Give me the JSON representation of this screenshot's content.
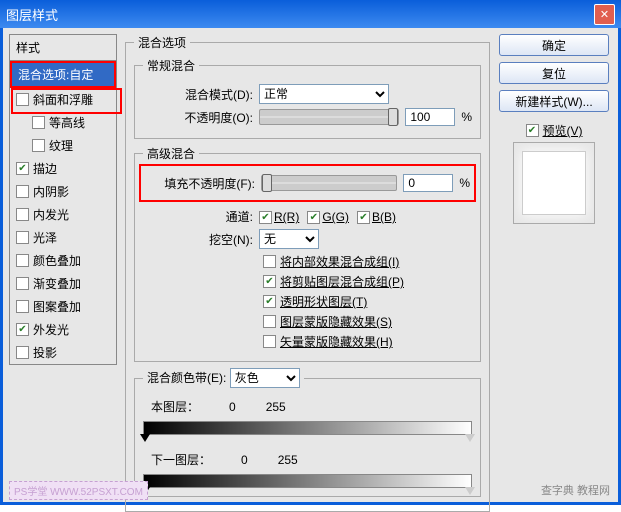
{
  "title": "图层样式",
  "leftcol": {
    "header": "样式",
    "selected": "混合选项:自定",
    "items": [
      {
        "label": "斜面和浮雕",
        "checked": false,
        "indent": false
      },
      {
        "label": "等高线",
        "checked": false,
        "indent": true
      },
      {
        "label": "纹理",
        "checked": false,
        "indent": true
      },
      {
        "label": "描边",
        "checked": true,
        "indent": false
      },
      {
        "label": "内阴影",
        "checked": false,
        "indent": false
      },
      {
        "label": "内发光",
        "checked": false,
        "indent": false
      },
      {
        "label": "光泽",
        "checked": false,
        "indent": false
      },
      {
        "label": "颜色叠加",
        "checked": false,
        "indent": false
      },
      {
        "label": "渐变叠加",
        "checked": false,
        "indent": false
      },
      {
        "label": "图案叠加",
        "checked": false,
        "indent": false
      },
      {
        "label": "外发光",
        "checked": true,
        "indent": false
      },
      {
        "label": "投影",
        "checked": false,
        "indent": false
      }
    ]
  },
  "blend": {
    "groupTitle": "混合选项",
    "normal": {
      "legend": "常规混合",
      "modeLabel": "混合模式(D):",
      "modeValue": "正常",
      "opacityLabel": "不透明度(O):",
      "opacityValue": "100",
      "percent": "%"
    },
    "advanced": {
      "legend": "高级混合",
      "fillLabel": "填充不透明度(F):",
      "fillValue": "0",
      "percent": "%",
      "channelsLabel": "通道:",
      "channels": [
        {
          "label": "R(R)",
          "checked": true
        },
        {
          "label": "G(G)",
          "checked": true
        },
        {
          "label": "B(B)",
          "checked": true
        }
      ],
      "knockoutLabel": "挖空(N):",
      "knockoutValue": "无",
      "options": [
        {
          "label": "将内部效果混合成组(I)",
          "checked": false
        },
        {
          "label": "将剪贴图层混合成组(P)",
          "checked": true
        },
        {
          "label": "透明形状图层(T)",
          "checked": true
        },
        {
          "label": "图层蒙版隐藏效果(S)",
          "checked": false
        },
        {
          "label": "矢量蒙版隐藏效果(H)",
          "checked": false
        }
      ]
    },
    "blendif": {
      "legend": "混合颜色带(E):",
      "channel": "灰色",
      "thisLabel": "本图层：",
      "thisMin": "0",
      "thisMax": "255",
      "underLabel": "下一图层：",
      "underMin": "0",
      "underMax": "255"
    }
  },
  "right": {
    "ok": "确定",
    "cancel": "复位",
    "newstyle": "新建样式(W)...",
    "previewLabel": "预览(V)"
  },
  "watermark": "查字典 教程网",
  "watermark2": "PS学堂  WWW.52PSXT.COM"
}
